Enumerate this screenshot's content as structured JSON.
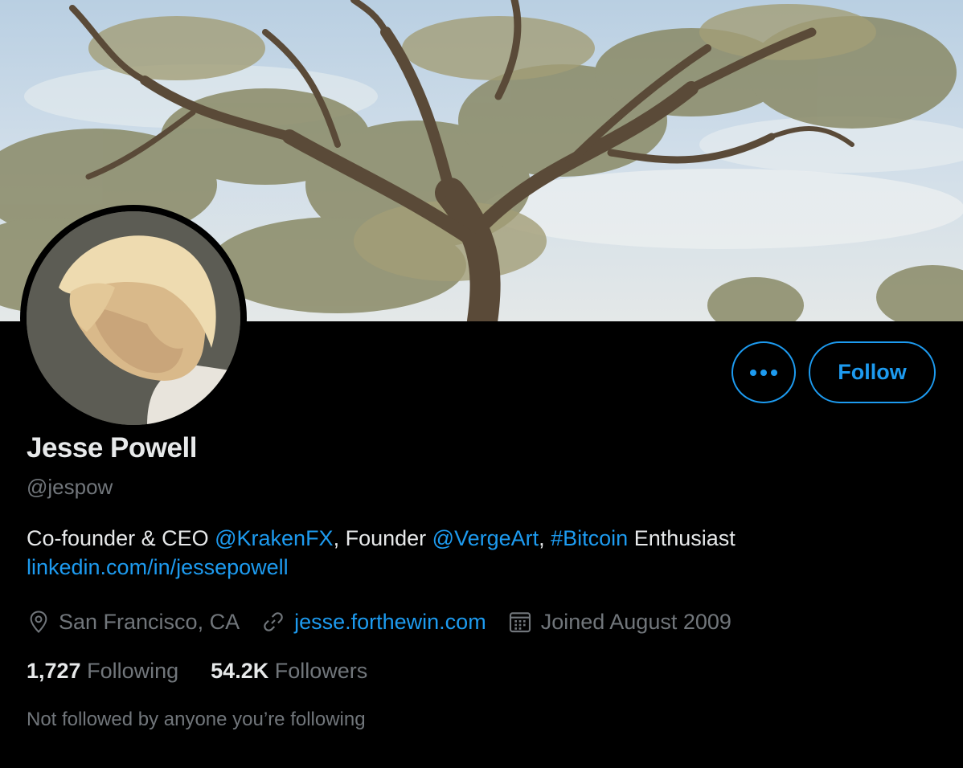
{
  "profile": {
    "name": "Jesse Powell",
    "handle": "@jespow",
    "bio": {
      "part1": "Co-founder & CEO ",
      "mention1": "@KrakenFX",
      "part2": ", Founder ",
      "mention2": "@VergeArt",
      "part3": ", ",
      "hashtag": "#Bitcoin",
      "part4": " Enthusiast",
      "link": "linkedin.com/in/jessepowell"
    },
    "location": "San Francisco, CA",
    "website": "jesse.forthewin.com",
    "joined": "Joined August 2009",
    "following_count": "1,727",
    "following_label": "Following",
    "followers_count": "54.2K",
    "followers_label": "Followers",
    "followed_by": "Not followed by anyone you’re following"
  },
  "actions": {
    "more_label": "•••",
    "follow_label": "Follow"
  },
  "icons": {
    "location": "location-pin-icon",
    "website": "link-icon",
    "joined": "calendar-icon",
    "more": "more-dots-icon"
  },
  "colors": {
    "accent": "#1d9bf0",
    "background": "#000000",
    "secondary_text": "#71767b",
    "primary_text": "#e7e9ea"
  }
}
